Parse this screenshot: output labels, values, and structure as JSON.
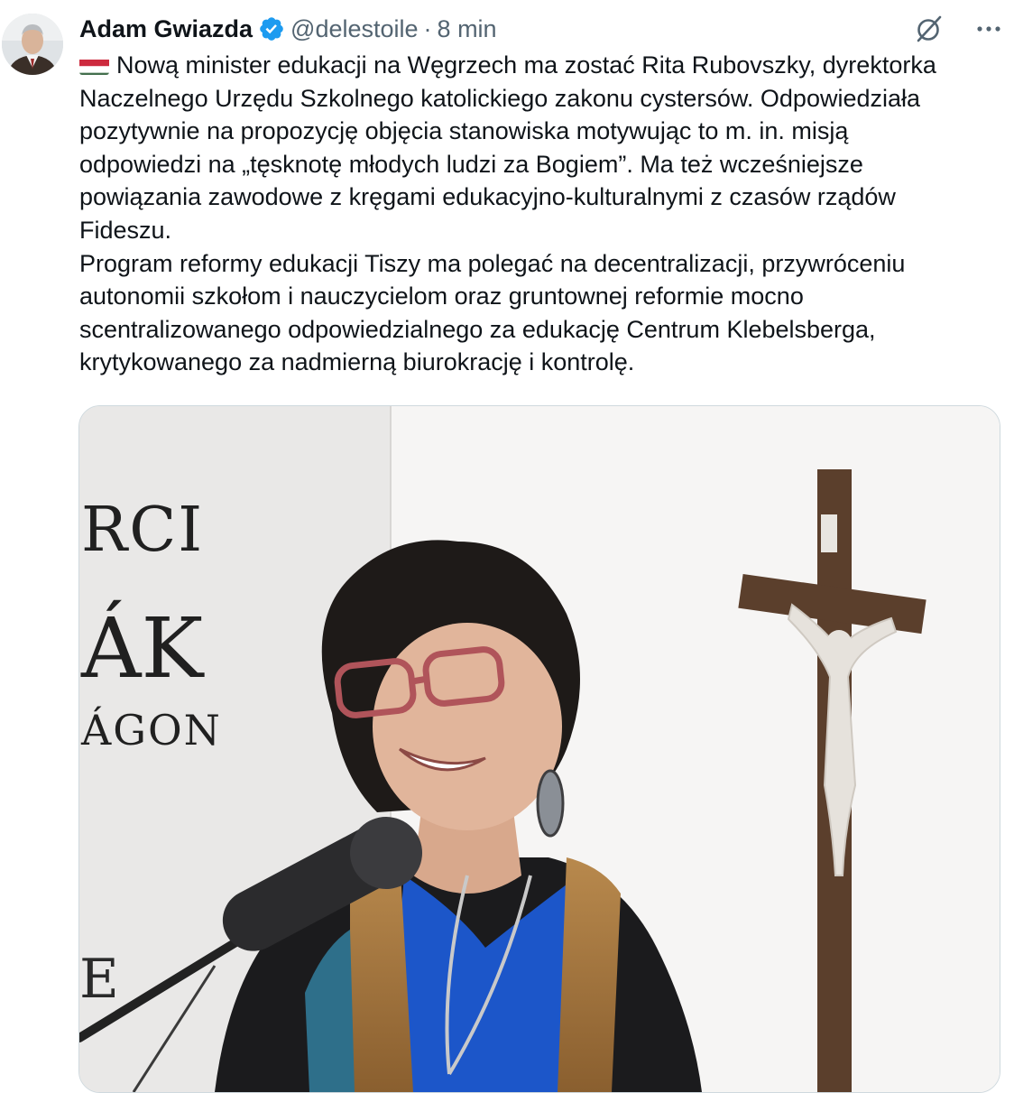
{
  "tweet": {
    "author": {
      "name": "Adam Gwiazda",
      "handle": "@delestoile",
      "verified": true,
      "avatar_icon": "user-avatar"
    },
    "separator": "·",
    "timestamp": "8 min",
    "flag_icon": "hungary-flag-icon",
    "paragraphs": [
      "Nową minister edukacji na Węgrzech ma zostać Rita Rubovszky, dyrektorka Naczelnego Urzędu Szkolnego katolickiego zakonu cystersów. Odpowiedziała pozytywnie na propozycję objęcia stanowiska motywując to m. in. misją odpowiedzi na „tęsknotę młodych ludzi za Bogiem”. Ma też wcześniejsze powiązania zawodowe z kręgami edukacyjno-kulturalnymi z czasów rządów Fideszu.",
      "Program reformy edukacji Tiszy ma polegać na decentralizacji, przywróceniu autonomii szkołom i nauczycielom oraz gruntownej reformie mocno scentralizowanego odpowiedzialnego za edukację Centrum Klebelsberga, krytykowanego za nadmierną biurokrację i kontrolę."
    ],
    "actions": {
      "grok_icon": "grok-icon",
      "more_icon": "more-options-icon"
    },
    "media": {
      "banner_lines": [
        "RCI",
        "ÁK",
        "ÁGON"
      ],
      "banner_fragment": "E"
    }
  },
  "colors": {
    "text": "#0f1419",
    "secondary": "#536471",
    "verified": "#1d9bf0",
    "border": "#cfd9de"
  }
}
